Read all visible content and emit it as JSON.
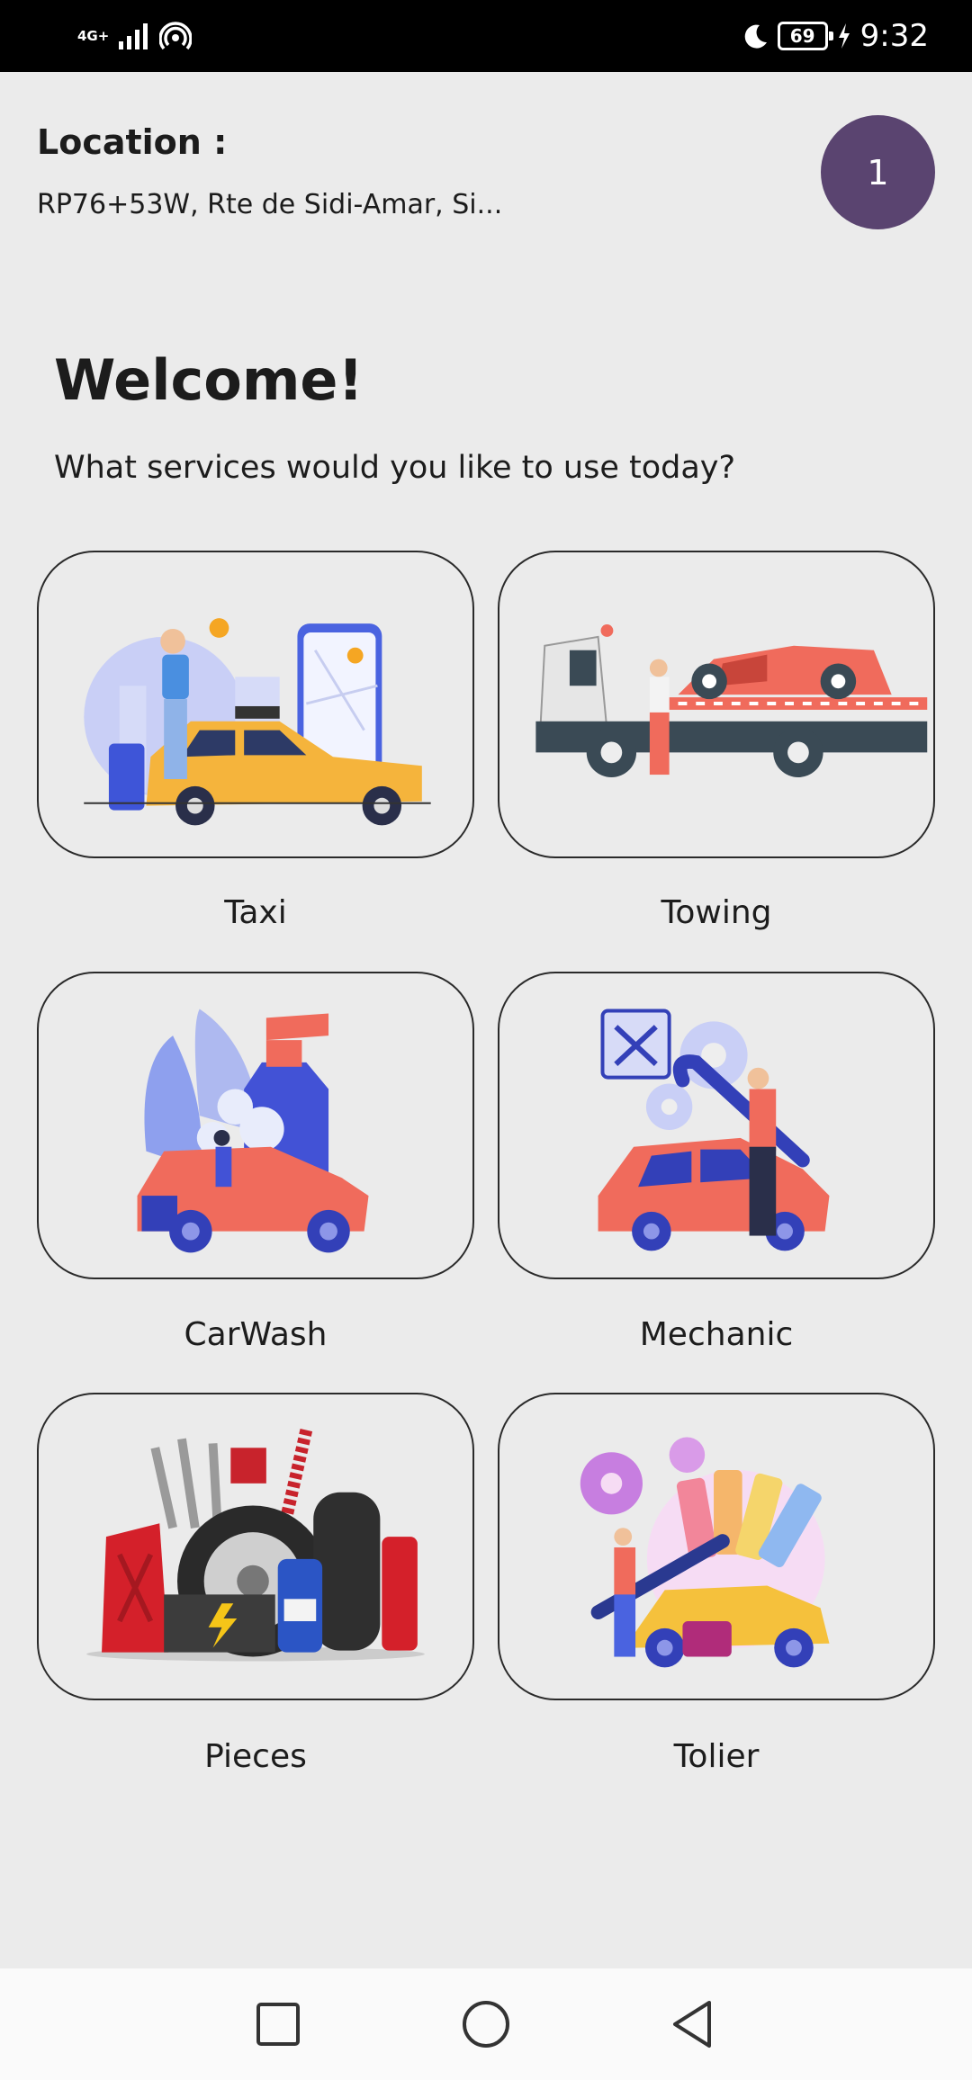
{
  "status_bar": {
    "network": "4G+",
    "battery": "69",
    "time": "9:32",
    "icons": [
      "signal-icon",
      "hotspot-icon",
      "moon-icon",
      "battery-icon",
      "charging-icon"
    ]
  },
  "header": {
    "location_title": "Location :",
    "location_value": "RP76+53W, Rte de Sidi-Amar, Si...",
    "badge_count": "1"
  },
  "main": {
    "welcome": "Welcome!",
    "subtitle": "What services would you like to use today?"
  },
  "services": [
    {
      "label": "Taxi"
    },
    {
      "label": "Towing"
    },
    {
      "label": "CarWash"
    },
    {
      "label": "Mechanic"
    },
    {
      "label": "Pieces"
    },
    {
      "label": "Tolier"
    }
  ],
  "colors": {
    "accent": "#5a4470",
    "background": "#ebebeb",
    "card_border": "#2a2a2a"
  }
}
